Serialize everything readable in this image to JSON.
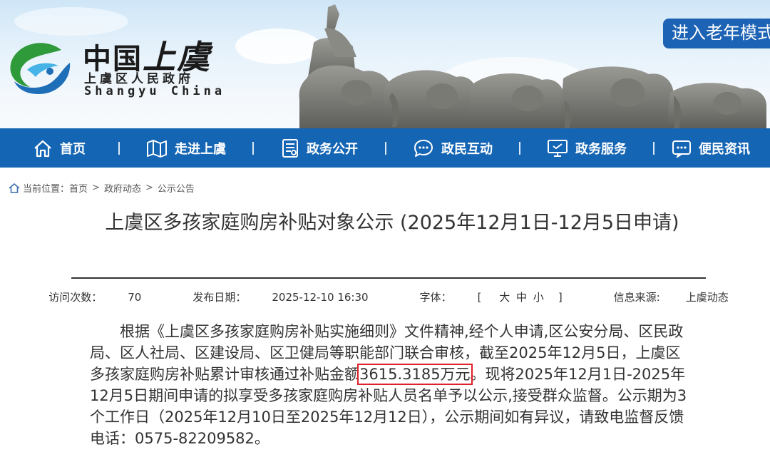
{
  "header": {
    "logo_cn_part1": "中国",
    "logo_cn_part2": "上虞",
    "logo_sub": "上虞区人民政府",
    "logo_en": "Shangyu China",
    "elder_mode_label": "进入老年模式"
  },
  "nav": {
    "items": [
      {
        "label": "首页",
        "icon": "home-icon"
      },
      {
        "label": "走进上虞",
        "icon": "map-icon"
      },
      {
        "label": "政务公开",
        "icon": "document-icon"
      },
      {
        "label": "政民互动",
        "icon": "chat-icon"
      },
      {
        "label": "政务服务",
        "icon": "monitor-icon"
      },
      {
        "label": "便民资讯",
        "icon": "info-icon"
      }
    ]
  },
  "breadcrumb": {
    "prefix": "当前位置：",
    "items": [
      "首页",
      "政府动态",
      "公示公告"
    ],
    "separator": ">"
  },
  "article": {
    "title": "上虞区多孩家庭购房补贴对象公示 (2025年12月1日-12月5日申请)",
    "visits_label": "访问次数：",
    "visits_value": "70",
    "date_label": "发布日期：",
    "date_value": "2025-12-10 16:30",
    "font_label": "字体：",
    "font_open": "[",
    "font_large": "大",
    "font_medium": "中",
    "font_small": "小",
    "font_close": "]",
    "source_label": "信息来源:",
    "source_value": "上虞动态",
    "body_before": "根据《上虞区多孩家庭购房补贴实施细则》文件精神,经个人申请,区公安分局、区民政局、区人社局、区建设局、区卫健局等职能部门联合审核，截至2025年12月5日，上虞区多孩家庭购房补贴累计审核通过补贴金额",
    "body_highlight": "3615.3185万元",
    "body_after": "。现将2025年12月1日-2025年12月5日期间申请的拟享受多孩家庭购房补贴人员名单予以公示,接受群众监督。公示期为3个工作日（2025年12月10日至2025年12月12日），公示期间如有异议，请致电监督反馈电话：0575-82209582。"
  },
  "colors": {
    "nav_bg": "#1565b5",
    "elder_btn_bg": "#1d63b5",
    "highlight_border": "#e0202a"
  }
}
